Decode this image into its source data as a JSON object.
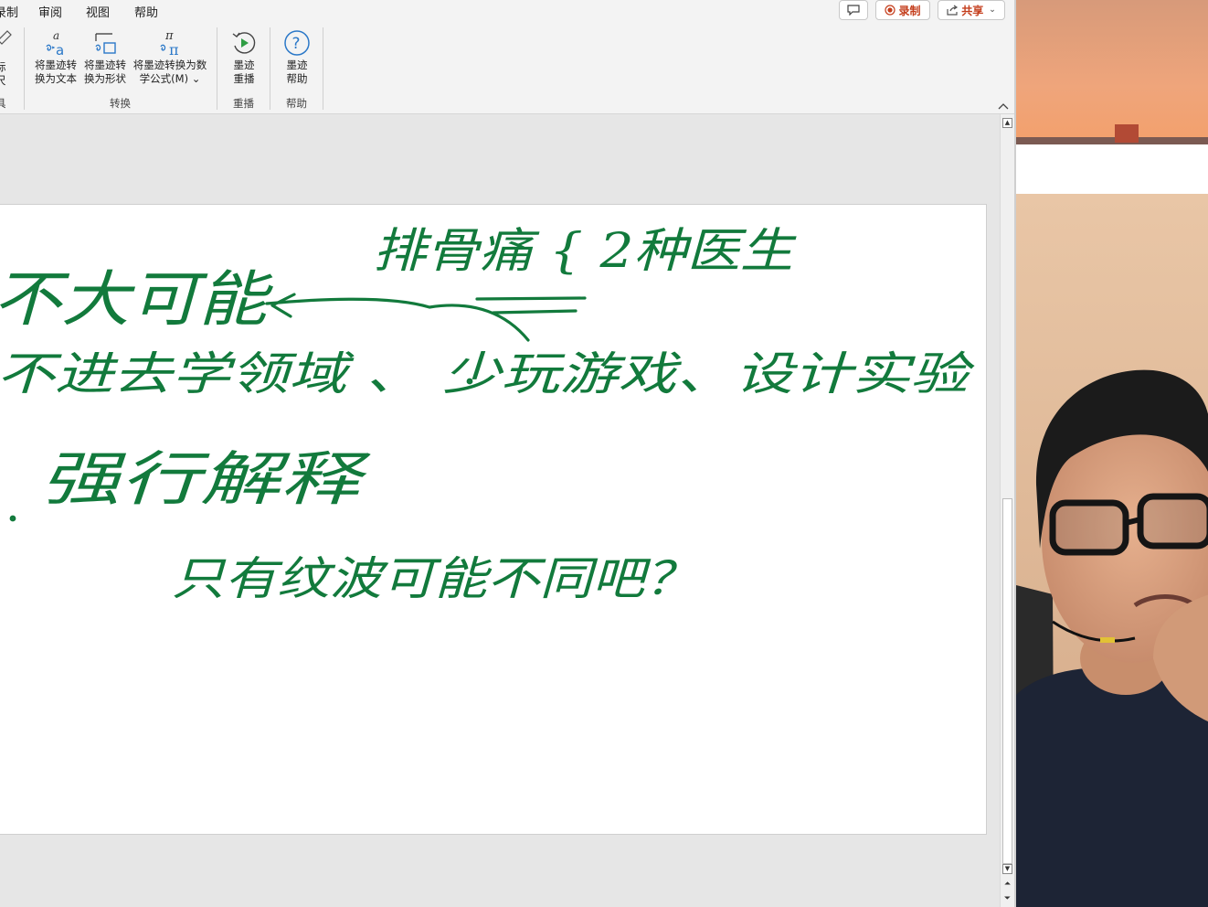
{
  "menu": {
    "items": [
      "录制",
      "审阅",
      "视图",
      "帮助"
    ],
    "comment_icon": "comment-icon",
    "record_button": "录制",
    "share_button": "共享"
  },
  "ribbon": {
    "partial_left_labels": [
      "标",
      "尺",
      "具"
    ],
    "buttons": [
      {
        "line1": "将墨迹转",
        "line2": "换为文本"
      },
      {
        "line1": "将墨迹转",
        "line2": "换为形状"
      },
      {
        "line1": "将墨迹转换为数",
        "line2": "学公式(M) ⌄"
      },
      {
        "line1": "墨迹",
        "line2": "重播"
      },
      {
        "line1": "墨迹",
        "line2": "帮助"
      }
    ],
    "groups": {
      "convert": "转换",
      "replay": "重播",
      "help": "帮助"
    }
  },
  "slide": {
    "ink_lines": [
      "排骨痛 { 2种医生",
      "不大可能",
      "不进去学领域 、 少玩游戏、设计实验",
      "强行解释",
      "只有纹波可能不同吧？"
    ],
    "ink_color": "#127a3c"
  },
  "colors": {
    "accent": "#c43e1c",
    "ink": "#127a3c"
  }
}
